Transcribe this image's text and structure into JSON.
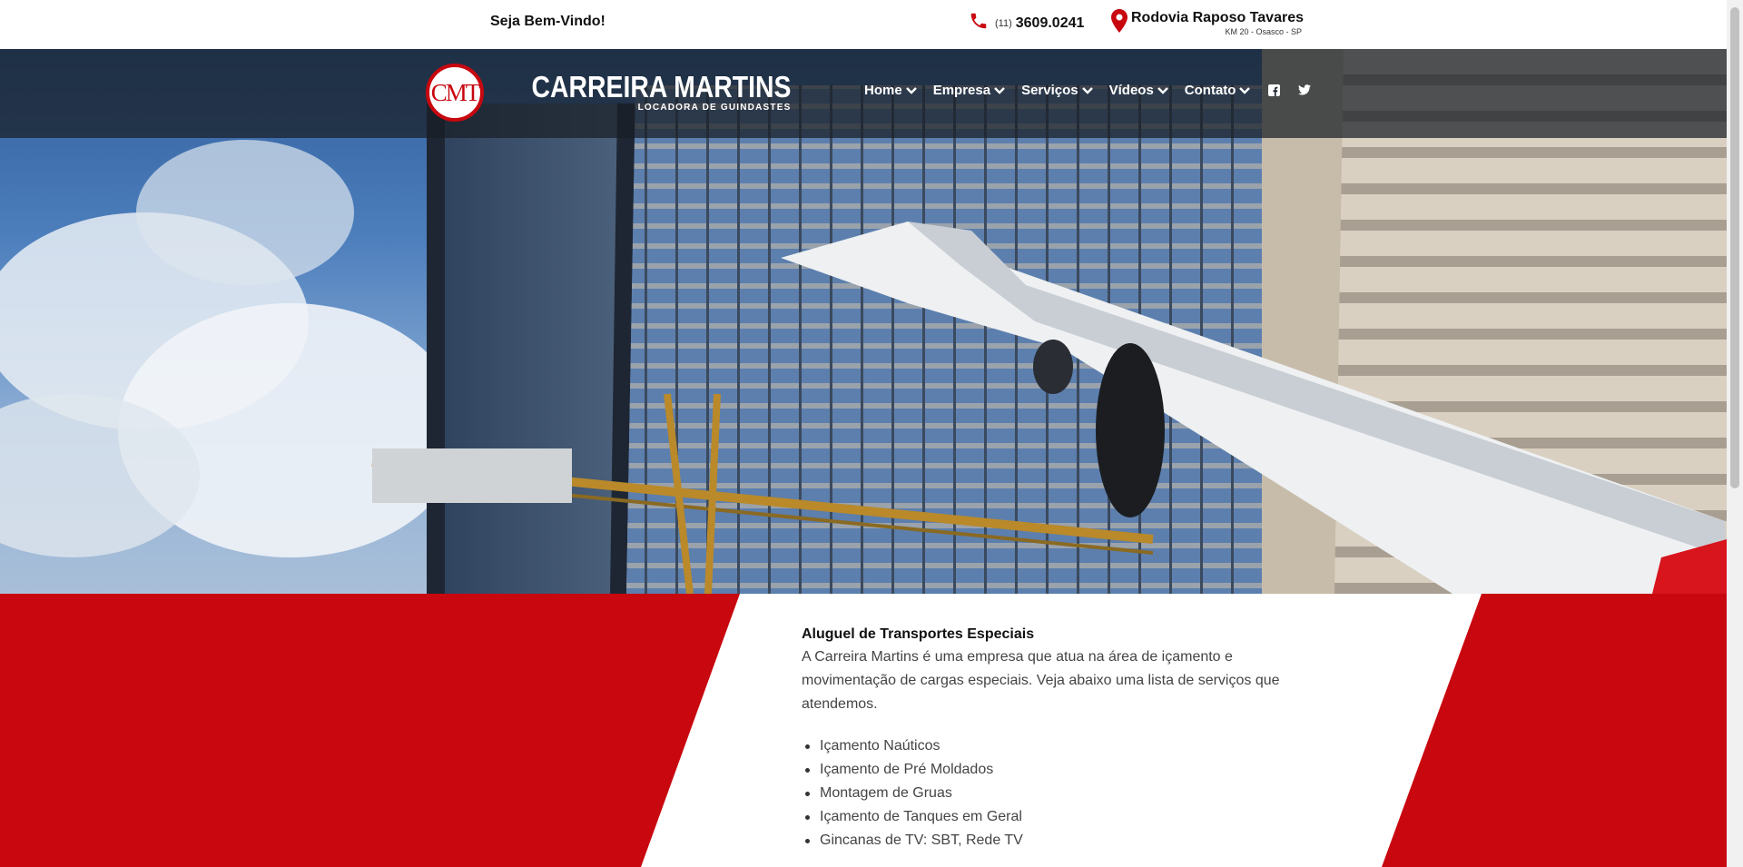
{
  "topbar": {
    "welcome": "Seja Bem-Vindo!",
    "phone_code": "(11)",
    "phone_number": "3609.0241",
    "location_title": "Rodovia Raposo Tavares",
    "location_sub": "KM 20 - Osasco - SP"
  },
  "logo": {
    "monogram": "CMT",
    "name": "CARREIRA MARTINS",
    "tagline": "LOCADORA DE GUINDASTES"
  },
  "nav": {
    "items": [
      {
        "label": "Home"
      },
      {
        "label": "Empresa"
      },
      {
        "label": "Serviços"
      },
      {
        "label": "Vídeos"
      },
      {
        "label": "Contato"
      }
    ],
    "social": [
      "facebook-icon",
      "twitter-icon"
    ]
  },
  "content": {
    "title": "Aluguel de Transportes Especiais",
    "description": "A Carreira Martins é uma empresa que atua na área de içamento e movimentação de cargas especiais. Veja abaixo uma lista de serviços que atendemos.",
    "services": [
      "Içamento Naúticos",
      "Içamento de Pré Moldados",
      "Montagem de Gruas",
      "Içamento de Tanques em Geral",
      "Gincanas de TV: SBT, Rede TV"
    ]
  },
  "colors": {
    "brand_red": "#c8070f",
    "navbar_overlay": "rgba(25,30,38,0.72)"
  }
}
